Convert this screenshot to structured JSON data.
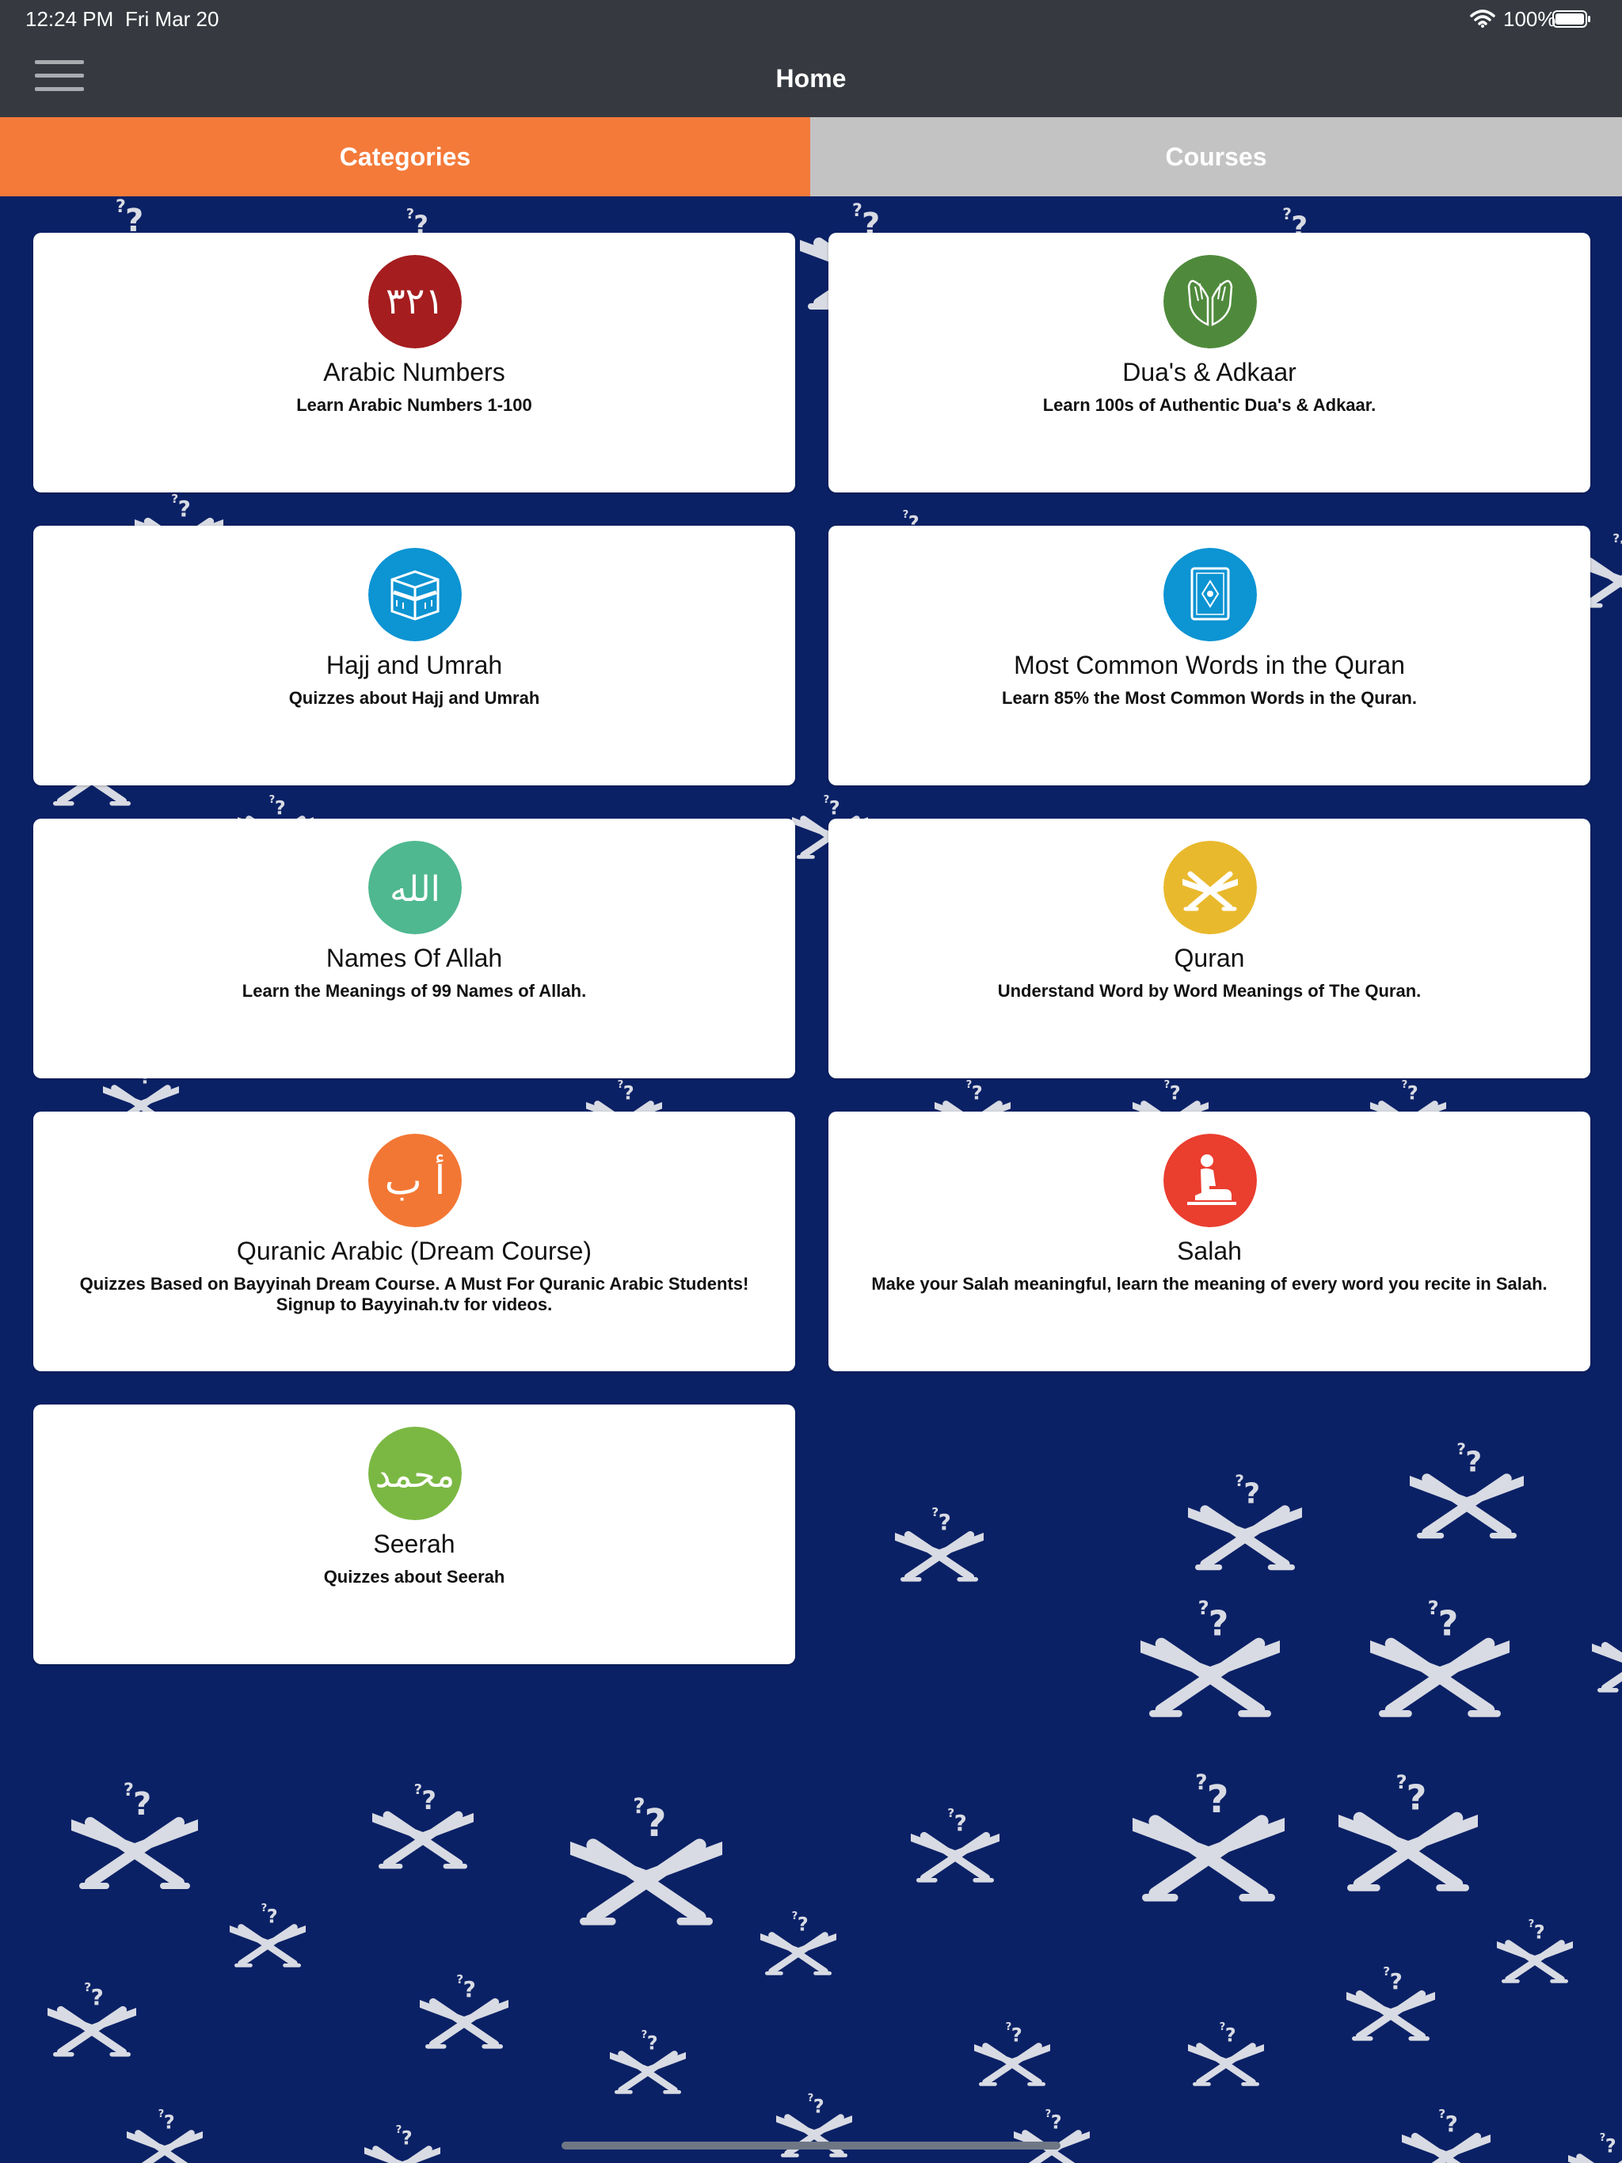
{
  "status": {
    "time": "12:24 PM",
    "date": "Fri Mar 20",
    "battery": "100%"
  },
  "nav": {
    "title": "Home"
  },
  "tabs": {
    "categories": "Categories",
    "courses": "Courses"
  },
  "colors": {
    "accent": "#f47a3a",
    "background": "#0b2166",
    "navbar": "#363a40",
    "tab_inactive": "#c3c3c3"
  },
  "cards": [
    {
      "title": "Arabic Numbers",
      "desc": "Learn Arabic Numbers 1-100",
      "icon": "arabic-numbers-icon",
      "color": "#a51d1f",
      "glyph": "٣٢١"
    },
    {
      "title": "Dua's & Adkaar",
      "desc": "Learn 100s of Authentic Dua's & Adkaar.",
      "icon": "praying-hands-icon",
      "color": "#4f8a3c"
    },
    {
      "title": "Hajj and Umrah",
      "desc": "Quizzes about Hajj and Umrah",
      "icon": "kaaba-icon",
      "color": "#0c94d3"
    },
    {
      "title": "Most Common Words in the Quran",
      "desc": "Learn 85% the Most Common Words in the Quran.",
      "icon": "quran-book-icon",
      "color": "#0c94d3"
    },
    {
      "title": "Names Of Allah",
      "desc": "Learn the Meanings of 99 Names of Allah.",
      "icon": "allah-calligraphy-icon",
      "color": "#4fb890",
      "glyph": "الله"
    },
    {
      "title": "Quran",
      "desc": "Understand Word by Word Meanings of The Quran.",
      "icon": "quran-stand-icon",
      "color": "#e9b92d"
    },
    {
      "title": "Quranic Arabic (Dream Course)",
      "desc": "Quizzes Based on Bayyinah Dream Course. A Must For Quranic Arabic Students! Signup to Bayyinah.tv for videos.",
      "icon": "arabic-letters-icon",
      "color": "#f37734",
      "glyph": "أ ب"
    },
    {
      "title": "Salah",
      "desc": "Make your Salah meaningful, learn the meaning of every word you recite in Salah.",
      "icon": "praying-person-icon",
      "color": "#ea3e2f"
    },
    {
      "title": "Seerah",
      "desc": "Quizzes about Seerah",
      "icon": "muhammad-calligraphy-icon",
      "color": "#7bb843",
      "glyph": "محمد"
    }
  ]
}
